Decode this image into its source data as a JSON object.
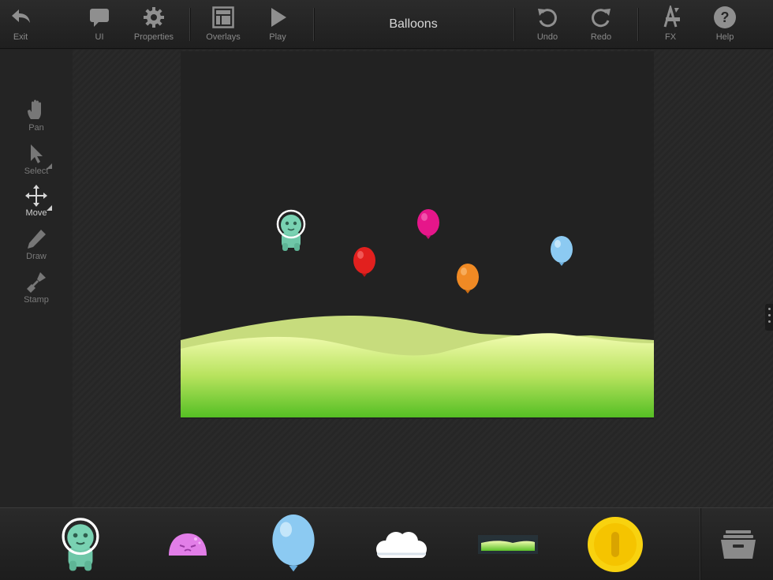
{
  "toolbar": {
    "exit": {
      "label": "Exit",
      "icon": "back-arrow-icon"
    },
    "ui": {
      "label": "UI",
      "icon": "speech-bubble-icon"
    },
    "properties": {
      "label": "Properties",
      "icon": "gear-icon"
    },
    "overlays": {
      "label": "Overlays",
      "icon": "layout-icon"
    },
    "play": {
      "label": "Play",
      "icon": "play-icon"
    },
    "title": "Balloons",
    "undo": {
      "label": "Undo",
      "icon": "undo-icon"
    },
    "redo": {
      "label": "Redo",
      "icon": "redo-icon"
    },
    "fx": {
      "label": "FX",
      "icon": "fx-icon"
    },
    "help": {
      "label": "Help",
      "icon": "help-icon"
    }
  },
  "tools": {
    "pan": {
      "label": "Pan",
      "icon": "hand-icon"
    },
    "select": {
      "label": "Select",
      "icon": "cursor-arrow-icon"
    },
    "move": {
      "label": "Move",
      "icon": "move-arrows-icon",
      "active": true
    },
    "draw": {
      "label": "Draw",
      "icon": "pencil-icon"
    },
    "stamp": {
      "label": "Stamp",
      "icon": "stamp-icon"
    }
  },
  "scene": {
    "balloons": [
      {
        "color": "#e81b8c"
      },
      {
        "color": "#e0201f"
      },
      {
        "color": "#f08a24"
      },
      {
        "color": "#8ccaf2"
      }
    ],
    "ground_colors": {
      "top": "#f2fbaf",
      "bottom": "#5dc328",
      "back": "#c6dc7c"
    }
  },
  "tray": {
    "items": [
      "alien-sprite",
      "pink-blob-sprite",
      "blue-balloon-sprite",
      "cloud-sprite",
      "grass-platform-sprite",
      "gold-coin-sprite"
    ],
    "archive_icon": "archive-drawer-icon"
  }
}
